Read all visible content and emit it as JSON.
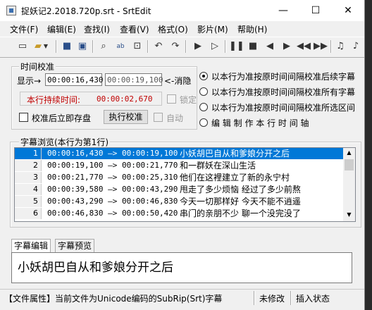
{
  "window": {
    "title": "捉妖记2.2018.720p.srt - SrtEdit",
    "minimize": "—",
    "maximize": "☐",
    "close": "✕"
  },
  "menu": [
    "文件(F)",
    "编辑(E)",
    "查找(I)",
    "查看(V)",
    "格式(O)",
    "影片(M)",
    "帮助(H)"
  ],
  "toolbar_icons": [
    "new-file-icon",
    "open-folder-icon",
    "save-icon",
    "save-all-icon",
    "find-icon",
    "replace-icon",
    "find-next-icon",
    "undo-icon",
    "redo-icon",
    "play-icon",
    "step-play-icon",
    "pause-icon",
    "stop-icon",
    "prev-icon",
    "next-icon",
    "rewind-icon",
    "fast-forward-icon",
    "note-icon",
    "settings-note-icon"
  ],
  "time_calibration": {
    "group_label": "时间校准",
    "display_label": "显示→",
    "start_time": "00:00:16,430",
    "end_time": "00:00:19,100",
    "cancel_label": "<-消隐",
    "duration_label": "本行持续时间:",
    "duration_value": "00:00:02,670",
    "lock_label": "锁定",
    "save_after_label": "校准后立即存盘",
    "execute_label": "执行校准",
    "auto_label": "自动",
    "options": [
      "以本行为准按原时间间隔校准后续字幕",
      "以本行为准按原时间间隔校准所有字幕",
      "以本行为准按原时间间隔校准所选区间",
      "编 辑 制 作 本 行 时 间 轴"
    ]
  },
  "browser": {
    "group_label": "字幕浏览(本行为第1行)",
    "rows": [
      {
        "num": "1",
        "times": "00:00:16,430 —> 00:00:19,100",
        "text": "小妖胡巴自从和爹娘分开之后"
      },
      {
        "num": "2",
        "times": "00:00:19,100 —> 00:00:21,770",
        "text": "和一群妖在深山生活"
      },
      {
        "num": "3",
        "times": "00:00:21,770 —> 00:00:25,310",
        "text": "他们在这裡建立了新的永宁村"
      },
      {
        "num": "4",
        "times": "00:00:39,580 —> 00:00:43,290",
        "text": "甩走了多少烦恼 经过了多少前熬"
      },
      {
        "num": "5",
        "times": "00:00:43,290 —> 00:00:46,830",
        "text": "今天一切那样好 今天不能不逍遥"
      },
      {
        "num": "6",
        "times": "00:00:46,830 —> 00:00:50,420",
        "text": "串门的亲朋不少 聊一个没完没了"
      }
    ]
  },
  "editor": {
    "tab_edit": "字幕编辑",
    "tab_preview": "字幕预览",
    "content": "小妖胡巴自从和爹娘分开之后"
  },
  "status": {
    "file_info": "【文件属性】当前文件为Unicode编码的SubRip(Srt)字幕",
    "modified": "未修改",
    "insert_mode": "插入状态"
  }
}
